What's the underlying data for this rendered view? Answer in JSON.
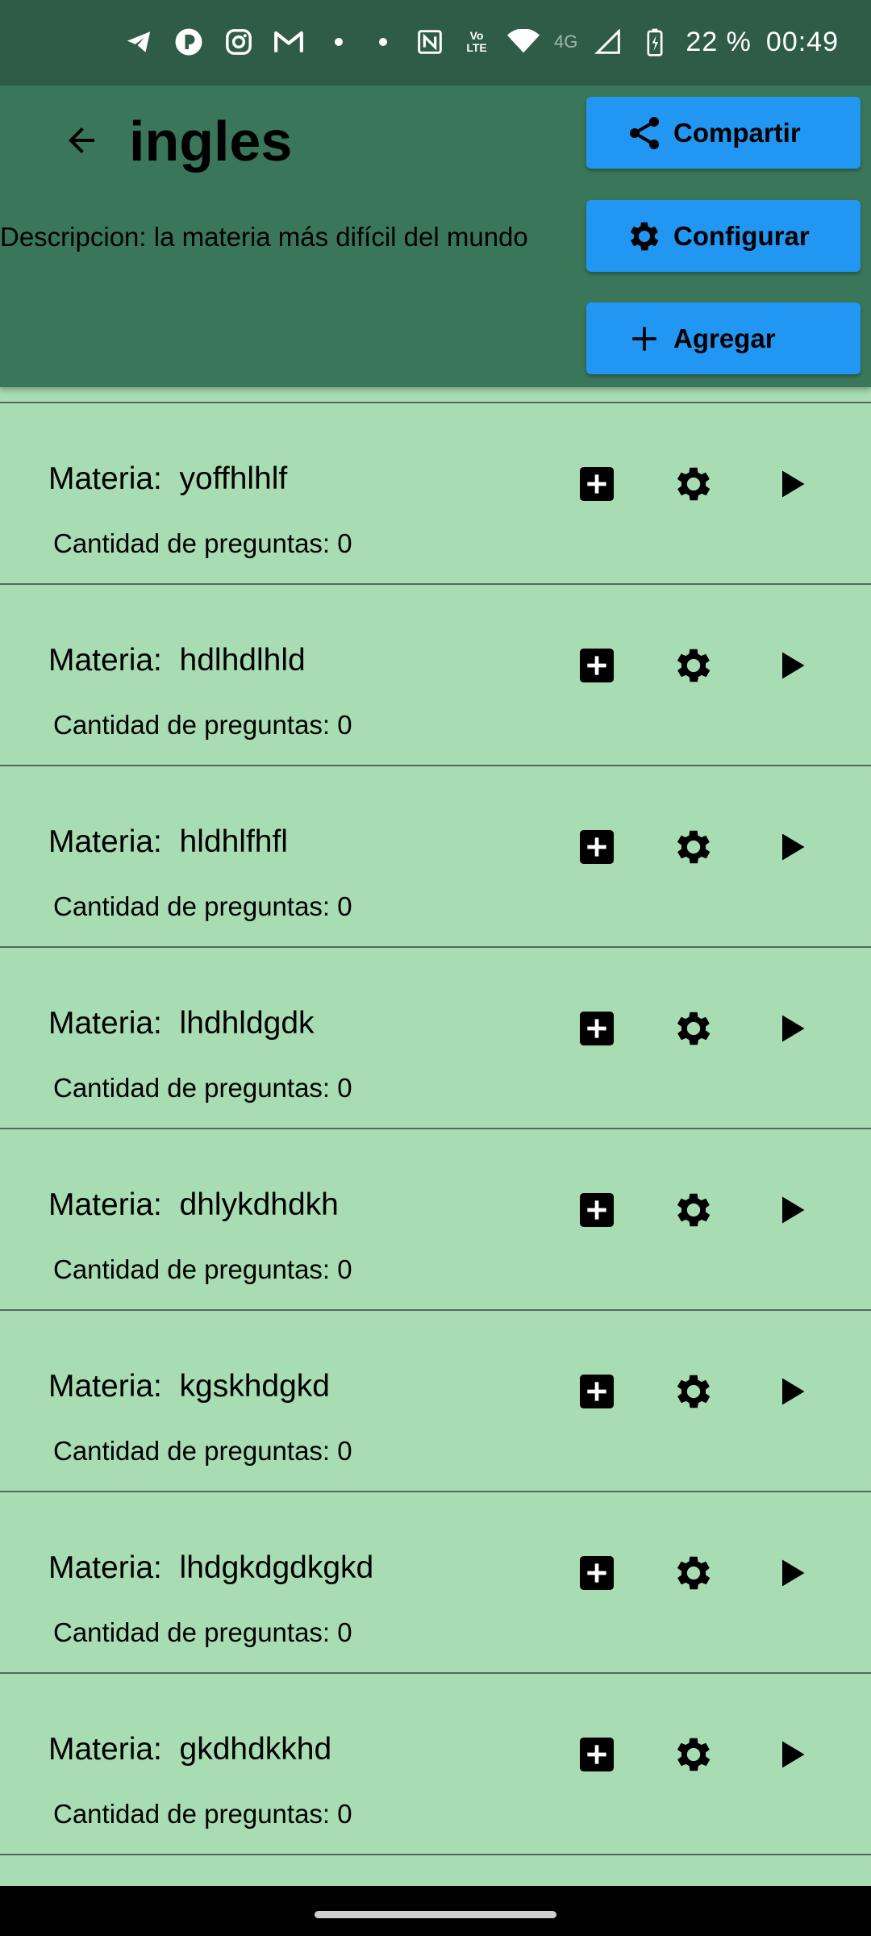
{
  "status_bar": {
    "battery": "22 %",
    "time": "00:49",
    "network": "4G",
    "volte_top": "Vo",
    "volte_bottom": "LTE",
    "left_icons": [
      "telegram-icon",
      "app-icon",
      "instagram-icon",
      "gmail-icon",
      "dot-icon"
    ],
    "right_icons": [
      "dot-icon",
      "nfc-icon",
      "volte-icon",
      "wifi-icon",
      "signal-icon",
      "battery-charging-icon"
    ]
  },
  "header": {
    "title": "ingles",
    "description": "Descripcion: la materia más difícil del mundo",
    "share_label": "Compartir",
    "configure_label": "Configurar",
    "add_label": "Agregar",
    "bg_color": "#3a775a",
    "button_color": "#2196f3"
  },
  "items": [
    {
      "title": "Materia:  yoffhlhlf",
      "count": "Cantidad de preguntas: 0"
    },
    {
      "title": "Materia:  hdlhdlhld",
      "count": "Cantidad de preguntas: 0"
    },
    {
      "title": "Materia:  hldhlfhfl",
      "count": "Cantidad de preguntas: 0"
    },
    {
      "title": "Materia:  lhdhldgdk",
      "count": "Cantidad de preguntas: 0"
    },
    {
      "title": "Materia:  dhlykdhdkh",
      "count": "Cantidad de preguntas: 0"
    },
    {
      "title": "Materia:  kgskhdgkd",
      "count": "Cantidad de preguntas: 0"
    },
    {
      "title": "Materia:  lhdgkdgdkgkd",
      "count": "Cantidad de preguntas: 0"
    },
    {
      "title": "Materia:  gkdhdkkhd",
      "count": "Cantidad de preguntas: 0"
    }
  ],
  "list_bg_color": "#a8dcb2"
}
